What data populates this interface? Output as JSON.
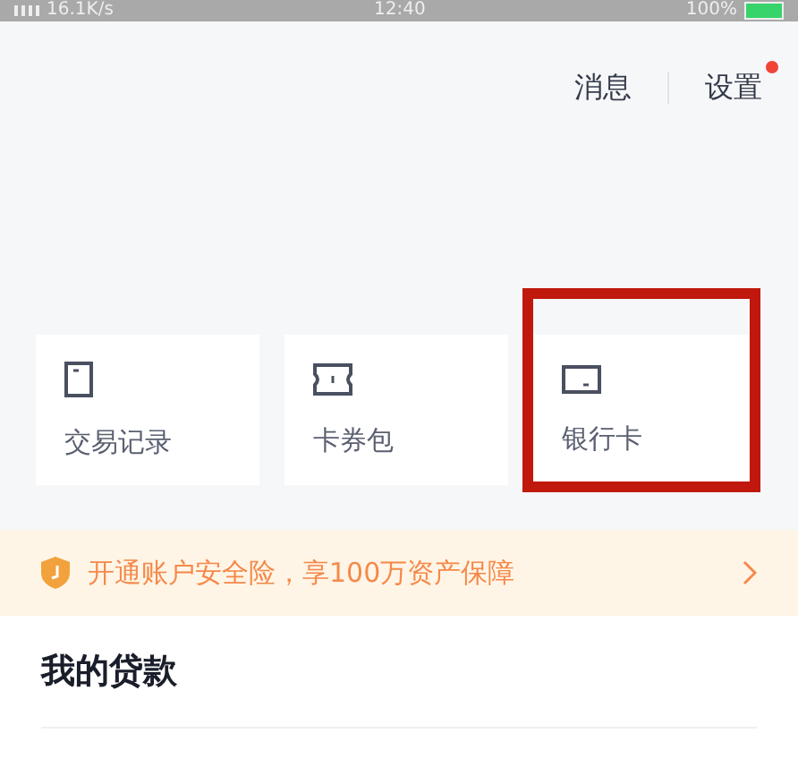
{
  "status_bar": {
    "speed": "16.1K/s",
    "time": "12:40",
    "battery": "100%"
  },
  "top_actions": [
    {
      "label": "消息",
      "badge": false
    },
    {
      "label": "设置",
      "badge": true
    }
  ],
  "shortcuts": [
    {
      "label": "交易记录",
      "highlighted": false
    },
    {
      "label": "卡券包",
      "highlighted": false
    },
    {
      "label": "银行卡",
      "highlighted": true
    }
  ],
  "banner": {
    "text": "开通账户安全险，享100万资产保障"
  },
  "loans": {
    "title": "我的贷款"
  }
}
